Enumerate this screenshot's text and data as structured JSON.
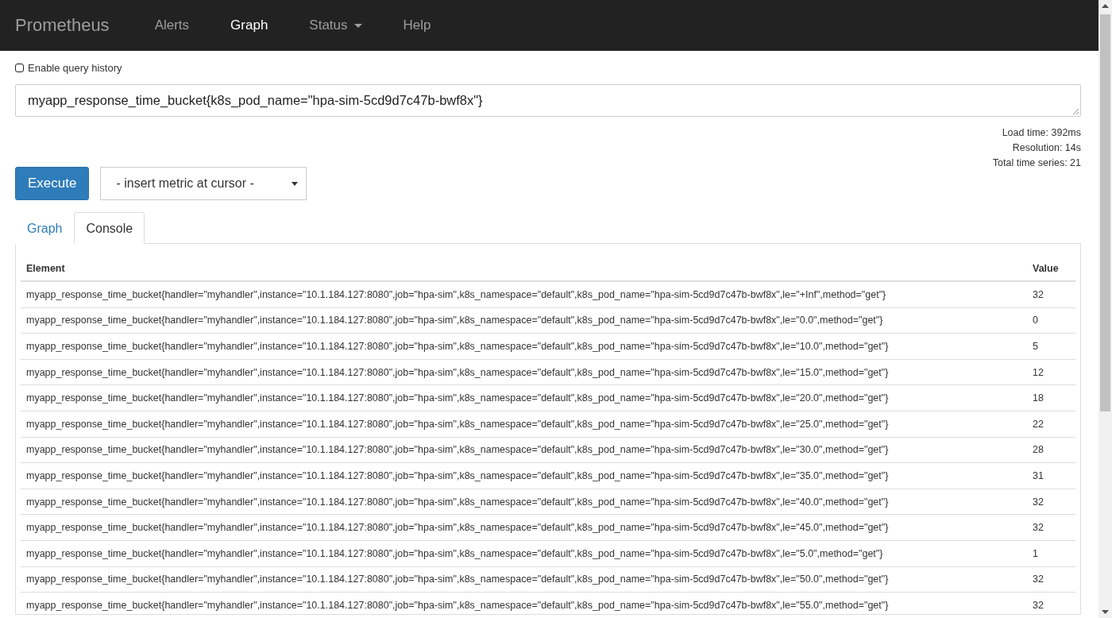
{
  "navbar": {
    "brand": "Prometheus",
    "items": [
      {
        "label": "Alerts",
        "selected": false,
        "dropdown": false
      },
      {
        "label": "Graph",
        "selected": true,
        "dropdown": false
      },
      {
        "label": "Status",
        "selected": false,
        "dropdown": true
      },
      {
        "label": "Help",
        "selected": false,
        "dropdown": false
      }
    ]
  },
  "query_history": {
    "label": "Enable query history",
    "checked": false
  },
  "expression": {
    "value": "myapp_response_time_bucket{k8s_pod_name=\"hpa-sim-5cd9d7c47b-bwf8x\"}"
  },
  "stats": [
    "Load time: 392ms",
    "Resolution: 14s",
    "Total time series: 21"
  ],
  "execute_button": "Execute",
  "metric_select": {
    "value": "- insert metric at cursor -"
  },
  "tabs": [
    {
      "label": "Graph",
      "selected": false
    },
    {
      "label": "Console",
      "selected": true
    }
  ],
  "table": {
    "columns": [
      "Element",
      "Value"
    ],
    "rows": [
      [
        "myapp_response_time_bucket{handler=\"myhandler\",instance=\"10.1.184.127:8080\",job=\"hpa-sim\",k8s_namespace=\"default\",k8s_pod_name=\"hpa-sim-5cd9d7c47b-bwf8x\",le=\"+Inf\",method=\"get\"}",
        "32"
      ],
      [
        "myapp_response_time_bucket{handler=\"myhandler\",instance=\"10.1.184.127:8080\",job=\"hpa-sim\",k8s_namespace=\"default\",k8s_pod_name=\"hpa-sim-5cd9d7c47b-bwf8x\",le=\"0.0\",method=\"get\"}",
        "0"
      ],
      [
        "myapp_response_time_bucket{handler=\"myhandler\",instance=\"10.1.184.127:8080\",job=\"hpa-sim\",k8s_namespace=\"default\",k8s_pod_name=\"hpa-sim-5cd9d7c47b-bwf8x\",le=\"10.0\",method=\"get\"}",
        "5"
      ],
      [
        "myapp_response_time_bucket{handler=\"myhandler\",instance=\"10.1.184.127:8080\",job=\"hpa-sim\",k8s_namespace=\"default\",k8s_pod_name=\"hpa-sim-5cd9d7c47b-bwf8x\",le=\"15.0\",method=\"get\"}",
        "12"
      ],
      [
        "myapp_response_time_bucket{handler=\"myhandler\",instance=\"10.1.184.127:8080\",job=\"hpa-sim\",k8s_namespace=\"default\",k8s_pod_name=\"hpa-sim-5cd9d7c47b-bwf8x\",le=\"20.0\",method=\"get\"}",
        "18"
      ],
      [
        "myapp_response_time_bucket{handler=\"myhandler\",instance=\"10.1.184.127:8080\",job=\"hpa-sim\",k8s_namespace=\"default\",k8s_pod_name=\"hpa-sim-5cd9d7c47b-bwf8x\",le=\"25.0\",method=\"get\"}",
        "22"
      ],
      [
        "myapp_response_time_bucket{handler=\"myhandler\",instance=\"10.1.184.127:8080\",job=\"hpa-sim\",k8s_namespace=\"default\",k8s_pod_name=\"hpa-sim-5cd9d7c47b-bwf8x\",le=\"30.0\",method=\"get\"}",
        "28"
      ],
      [
        "myapp_response_time_bucket{handler=\"myhandler\",instance=\"10.1.184.127:8080\",job=\"hpa-sim\",k8s_namespace=\"default\",k8s_pod_name=\"hpa-sim-5cd9d7c47b-bwf8x\",le=\"35.0\",method=\"get\"}",
        "31"
      ],
      [
        "myapp_response_time_bucket{handler=\"myhandler\",instance=\"10.1.184.127:8080\",job=\"hpa-sim\",k8s_namespace=\"default\",k8s_pod_name=\"hpa-sim-5cd9d7c47b-bwf8x\",le=\"40.0\",method=\"get\"}",
        "32"
      ],
      [
        "myapp_response_time_bucket{handler=\"myhandler\",instance=\"10.1.184.127:8080\",job=\"hpa-sim\",k8s_namespace=\"default\",k8s_pod_name=\"hpa-sim-5cd9d7c47b-bwf8x\",le=\"45.0\",method=\"get\"}",
        "32"
      ],
      [
        "myapp_response_time_bucket{handler=\"myhandler\",instance=\"10.1.184.127:8080\",job=\"hpa-sim\",k8s_namespace=\"default\",k8s_pod_name=\"hpa-sim-5cd9d7c47b-bwf8x\",le=\"5.0\",method=\"get\"}",
        "1"
      ],
      [
        "myapp_response_time_bucket{handler=\"myhandler\",instance=\"10.1.184.127:8080\",job=\"hpa-sim\",k8s_namespace=\"default\",k8s_pod_name=\"hpa-sim-5cd9d7c47b-bwf8x\",le=\"50.0\",method=\"get\"}",
        "32"
      ],
      [
        "myapp_response_time_bucket{handler=\"myhandler\",instance=\"10.1.184.127:8080\",job=\"hpa-sim\",k8s_namespace=\"default\",k8s_pod_name=\"hpa-sim-5cd9d7c47b-bwf8x\",le=\"55.0\",method=\"get\"}",
        "32"
      ]
    ]
  }
}
